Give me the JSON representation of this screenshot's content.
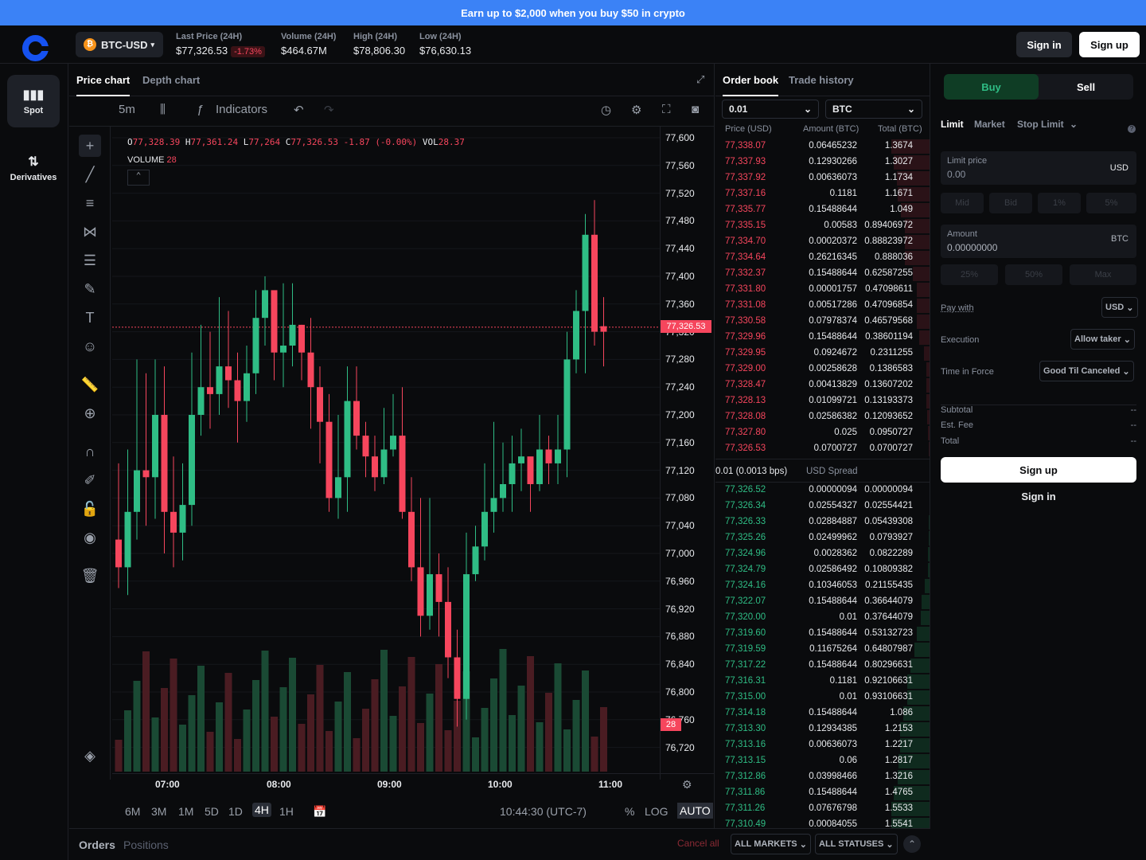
{
  "banner": {
    "text": "Earn up to $2,000 when you buy $50 in crypto"
  },
  "header": {
    "pair": "BTC-USD",
    "coin_letter": "₿",
    "stats": [
      {
        "label": "Last Price (24H)",
        "value": "$77,326.53",
        "change": "-1.73%"
      },
      {
        "label": "Volume (24H)",
        "value": "$464.67M"
      },
      {
        "label": "High (24H)",
        "value": "$78,806.30"
      },
      {
        "label": "Low (24H)",
        "value": "$76,630.13"
      }
    ],
    "sign_in": "Sign in",
    "sign_up": "Sign up"
  },
  "nav": {
    "spot": "Spot",
    "derivatives": "Derivatives"
  },
  "chart_panel": {
    "tabs": [
      "Price chart",
      "Depth chart"
    ],
    "interval": "5m",
    "indicators": "Indicators",
    "ohlc": {
      "o": "77,328.39",
      "h": "77,361.24",
      "l": "77,264",
      "c": "77,326.53",
      "chg": "-1.87 (-0.00%)",
      "vol": "28.37"
    },
    "volume_label": "VOLUME",
    "volume_value": "28",
    "current_price_tag": "77,326.53",
    "volume_tag": "28",
    "ranges": [
      "6M",
      "3M",
      "1M",
      "5D",
      "1D",
      "4H",
      "1H"
    ],
    "active_range": "4H",
    "clock": "10:44:30 (UTC-7)",
    "pct": "%",
    "log": "LOG",
    "auto": "AUTO"
  },
  "chart_data": {
    "type": "candlestick",
    "y_ticks": [
      "77,600",
      "77,560",
      "77,520",
      "77,480",
      "77,440",
      "77,400",
      "77,360",
      "77,320",
      "77,280",
      "77,240",
      "77,200",
      "77,160",
      "77,120",
      "77,080",
      "77,040",
      "77,000",
      "76,960",
      "76,920",
      "76,880",
      "76,840",
      "76,800",
      "76,760",
      "76,720"
    ],
    "x_ticks": [
      "07:00",
      "08:00",
      "09:00",
      "10:00",
      "11:00"
    ],
    "ylim": [
      76700,
      77610
    ],
    "candles": [
      [
        77020,
        76980,
        77130,
        76950,
        "d"
      ],
      [
        76980,
        77060,
        77150,
        76940,
        "u"
      ],
      [
        77060,
        77120,
        77280,
        77020,
        "u"
      ],
      [
        77120,
        77110,
        77260,
        77040,
        "d"
      ],
      [
        77110,
        77200,
        77280,
        77050,
        "u"
      ],
      [
        77200,
        77060,
        77270,
        77000,
        "d"
      ],
      [
        77060,
        77030,
        77140,
        76980,
        "d"
      ],
      [
        77030,
        77070,
        77130,
        76990,
        "u"
      ],
      [
        77070,
        77200,
        77290,
        77040,
        "u"
      ],
      [
        77200,
        77240,
        77330,
        77170,
        "u"
      ],
      [
        77240,
        77230,
        77320,
        77180,
        "d"
      ],
      [
        77230,
        77270,
        77370,
        77200,
        "u"
      ],
      [
        77270,
        77250,
        77350,
        77210,
        "d"
      ],
      [
        77250,
        77220,
        77290,
        77160,
        "d"
      ],
      [
        77220,
        77260,
        77300,
        77190,
        "u"
      ],
      [
        77260,
        77340,
        77380,
        77230,
        "u"
      ],
      [
        77340,
        77380,
        77400,
        77300,
        "u"
      ],
      [
        77380,
        77290,
        77370,
        77250,
        "d"
      ],
      [
        77290,
        77300,
        77390,
        77240,
        "u"
      ],
      [
        77300,
        77330,
        77390,
        77270,
        "u"
      ],
      [
        77330,
        77290,
        77330,
        77250,
        "d"
      ],
      [
        77290,
        77240,
        77340,
        77180,
        "d"
      ],
      [
        77240,
        77190,
        77270,
        77130,
        "d"
      ],
      [
        77190,
        77080,
        77230,
        77060,
        "d"
      ],
      [
        77080,
        77110,
        77200,
        77050,
        "u"
      ],
      [
        77110,
        77220,
        77270,
        77060,
        "u"
      ],
      [
        77220,
        77170,
        77270,
        77150,
        "d"
      ],
      [
        77170,
        77140,
        77190,
        77110,
        "d"
      ],
      [
        77140,
        77110,
        77170,
        77090,
        "d"
      ],
      [
        77110,
        77150,
        77210,
        77100,
        "u"
      ],
      [
        77150,
        77170,
        77230,
        77140,
        "u"
      ],
      [
        77170,
        77060,
        77240,
        77050,
        "d"
      ],
      [
        77060,
        76980,
        77110,
        76960,
        "d"
      ],
      [
        76980,
        76910,
        77080,
        76880,
        "d"
      ],
      [
        76910,
        76970,
        77080,
        76890,
        "u"
      ],
      [
        76970,
        76930,
        77000,
        76880,
        "d"
      ],
      [
        76930,
        76850,
        76980,
        76820,
        "d"
      ],
      [
        76850,
        76790,
        76890,
        76750,
        "d"
      ],
      [
        76790,
        76970,
        77030,
        76760,
        "u"
      ],
      [
        76970,
        77010,
        77040,
        76960,
        "u"
      ],
      [
        77010,
        77060,
        77130,
        76990,
        "u"
      ],
      [
        77060,
        77080,
        77190,
        77030,
        "u"
      ],
      [
        77080,
        77100,
        77160,
        77060,
        "u"
      ],
      [
        77100,
        77130,
        77170,
        77060,
        "u"
      ],
      [
        77130,
        77140,
        77180,
        77090,
        "u"
      ],
      [
        77140,
        77100,
        77130,
        77060,
        "d"
      ],
      [
        77100,
        77150,
        77200,
        77090,
        "u"
      ],
      [
        77150,
        77130,
        77170,
        77100,
        "d"
      ],
      [
        77130,
        77150,
        77200,
        77100,
        "u"
      ],
      [
        77150,
        77280,
        77320,
        77110,
        "u"
      ],
      [
        77280,
        77350,
        77380,
        77260,
        "u"
      ],
      [
        77350,
        77460,
        77490,
        77260,
        "u"
      ],
      [
        77460,
        77320,
        77510,
        77300,
        "d"
      ],
      [
        77320,
        77328,
        77370,
        77270,
        "d"
      ]
    ]
  },
  "order_book": {
    "tabs": [
      "Order book",
      "Trade history"
    ],
    "tick": "0.01",
    "asset": "BTC",
    "headers": [
      "Price (USD)",
      "Amount (BTC)",
      "Total (BTC)"
    ],
    "asks": [
      [
        "77,338.07",
        "0.06465232",
        "1.3674"
      ],
      [
        "77,337.93",
        "0.12930266",
        "1.3027"
      ],
      [
        "77,337.92",
        "0.00636073",
        "1.1734"
      ],
      [
        "77,337.16",
        "0.1181",
        "1.1671"
      ],
      [
        "77,335.77",
        "0.15488644",
        "1.049"
      ],
      [
        "77,335.15",
        "0.00583",
        "0.89406972"
      ],
      [
        "77,334.70",
        "0.00020372",
        "0.88823972"
      ],
      [
        "77,334.64",
        "0.26216345",
        "0.888036"
      ],
      [
        "77,332.37",
        "0.15488644",
        "0.62587255"
      ],
      [
        "77,331.80",
        "0.00001757",
        "0.47098611"
      ],
      [
        "77,331.08",
        "0.00517286",
        "0.47096854"
      ],
      [
        "77,330.58",
        "0.07978374",
        "0.46579568"
      ],
      [
        "77,329.96",
        "0.15488644",
        "0.38601194"
      ],
      [
        "77,329.95",
        "0.0924672",
        "0.2311255"
      ],
      [
        "77,329.00",
        "0.00258628",
        "0.1386583"
      ],
      [
        "77,328.47",
        "0.00413829",
        "0.13607202"
      ],
      [
        "77,328.13",
        "0.01099721",
        "0.13193373"
      ],
      [
        "77,328.08",
        "0.02586382",
        "0.12093652"
      ],
      [
        "77,327.80",
        "0.025",
        "0.0950727"
      ],
      [
        "77,326.53",
        "0.0700727",
        "0.0700727"
      ]
    ],
    "spread_value": "0.01 (0.0013 bps)",
    "spread_label": "USD Spread",
    "bids": [
      [
        "77,326.52",
        "0.00000094",
        "0.00000094"
      ],
      [
        "77,326.34",
        "0.02554327",
        "0.02554421"
      ],
      [
        "77,326.33",
        "0.02884887",
        "0.05439308"
      ],
      [
        "77,325.26",
        "0.02499962",
        "0.0793927"
      ],
      [
        "77,324.96",
        "0.0028362",
        "0.0822289"
      ],
      [
        "77,324.79",
        "0.02586492",
        "0.10809382"
      ],
      [
        "77,324.16",
        "0.10346053",
        "0.21155435"
      ],
      [
        "77,322.07",
        "0.15488644",
        "0.36644079"
      ],
      [
        "77,320.00",
        "0.01",
        "0.37644079"
      ],
      [
        "77,319.60",
        "0.15488644",
        "0.53132723"
      ],
      [
        "77,319.59",
        "0.11675264",
        "0.64807987"
      ],
      [
        "77,317.22",
        "0.15488644",
        "0.80296631"
      ],
      [
        "77,316.31",
        "0.1181",
        "0.92106631"
      ],
      [
        "77,315.00",
        "0.01",
        "0.93106631"
      ],
      [
        "77,314.18",
        "0.15488644",
        "1.086"
      ],
      [
        "77,313.30",
        "0.12934385",
        "1.2153"
      ],
      [
        "77,313.16",
        "0.00636073",
        "1.2217"
      ],
      [
        "77,313.15",
        "0.06",
        "1.2817"
      ],
      [
        "77,312.86",
        "0.03998466",
        "1.3216"
      ],
      [
        "77,311.86",
        "0.15488644",
        "1.4765"
      ],
      [
        "77,311.26",
        "0.07676798",
        "1.5533"
      ],
      [
        "77,310.49",
        "0.00084055",
        "1.5541"
      ]
    ]
  },
  "trade": {
    "buy": "Buy",
    "sell": "Sell",
    "order_types": [
      "Limit",
      "Market",
      "Stop Limit"
    ],
    "limit_price_label": "Limit price",
    "limit_price_value": "0.00",
    "limit_unit": "USD",
    "price_chips": [
      "Mid",
      "Bid",
      "1%",
      "5%"
    ],
    "amount_label": "Amount",
    "amount_value": "0.00000000",
    "amount_unit": "BTC",
    "amount_chips": [
      "25%",
      "50%",
      "Max"
    ],
    "pay_with_label": "Pay with",
    "pay_with_value": "USD",
    "execution_label": "Execution",
    "execution_value": "Allow taker",
    "tif_label": "Time in Force",
    "tif_value": "Good Til Canceled",
    "subtotal_label": "Subtotal",
    "fee_label": "Est. Fee",
    "total_label": "Total",
    "dash": "--",
    "sign_up": "Sign up",
    "sign_in": "Sign in"
  },
  "orders_bar": {
    "tabs": [
      "Orders",
      "Positions"
    ],
    "cancel_all": "Cancel all",
    "markets": "ALL MARKETS",
    "statuses": "ALL STATUSES"
  },
  "colors": {
    "up": "#2fbd85",
    "down": "#f6465d",
    "accent": "#3b82f6"
  }
}
